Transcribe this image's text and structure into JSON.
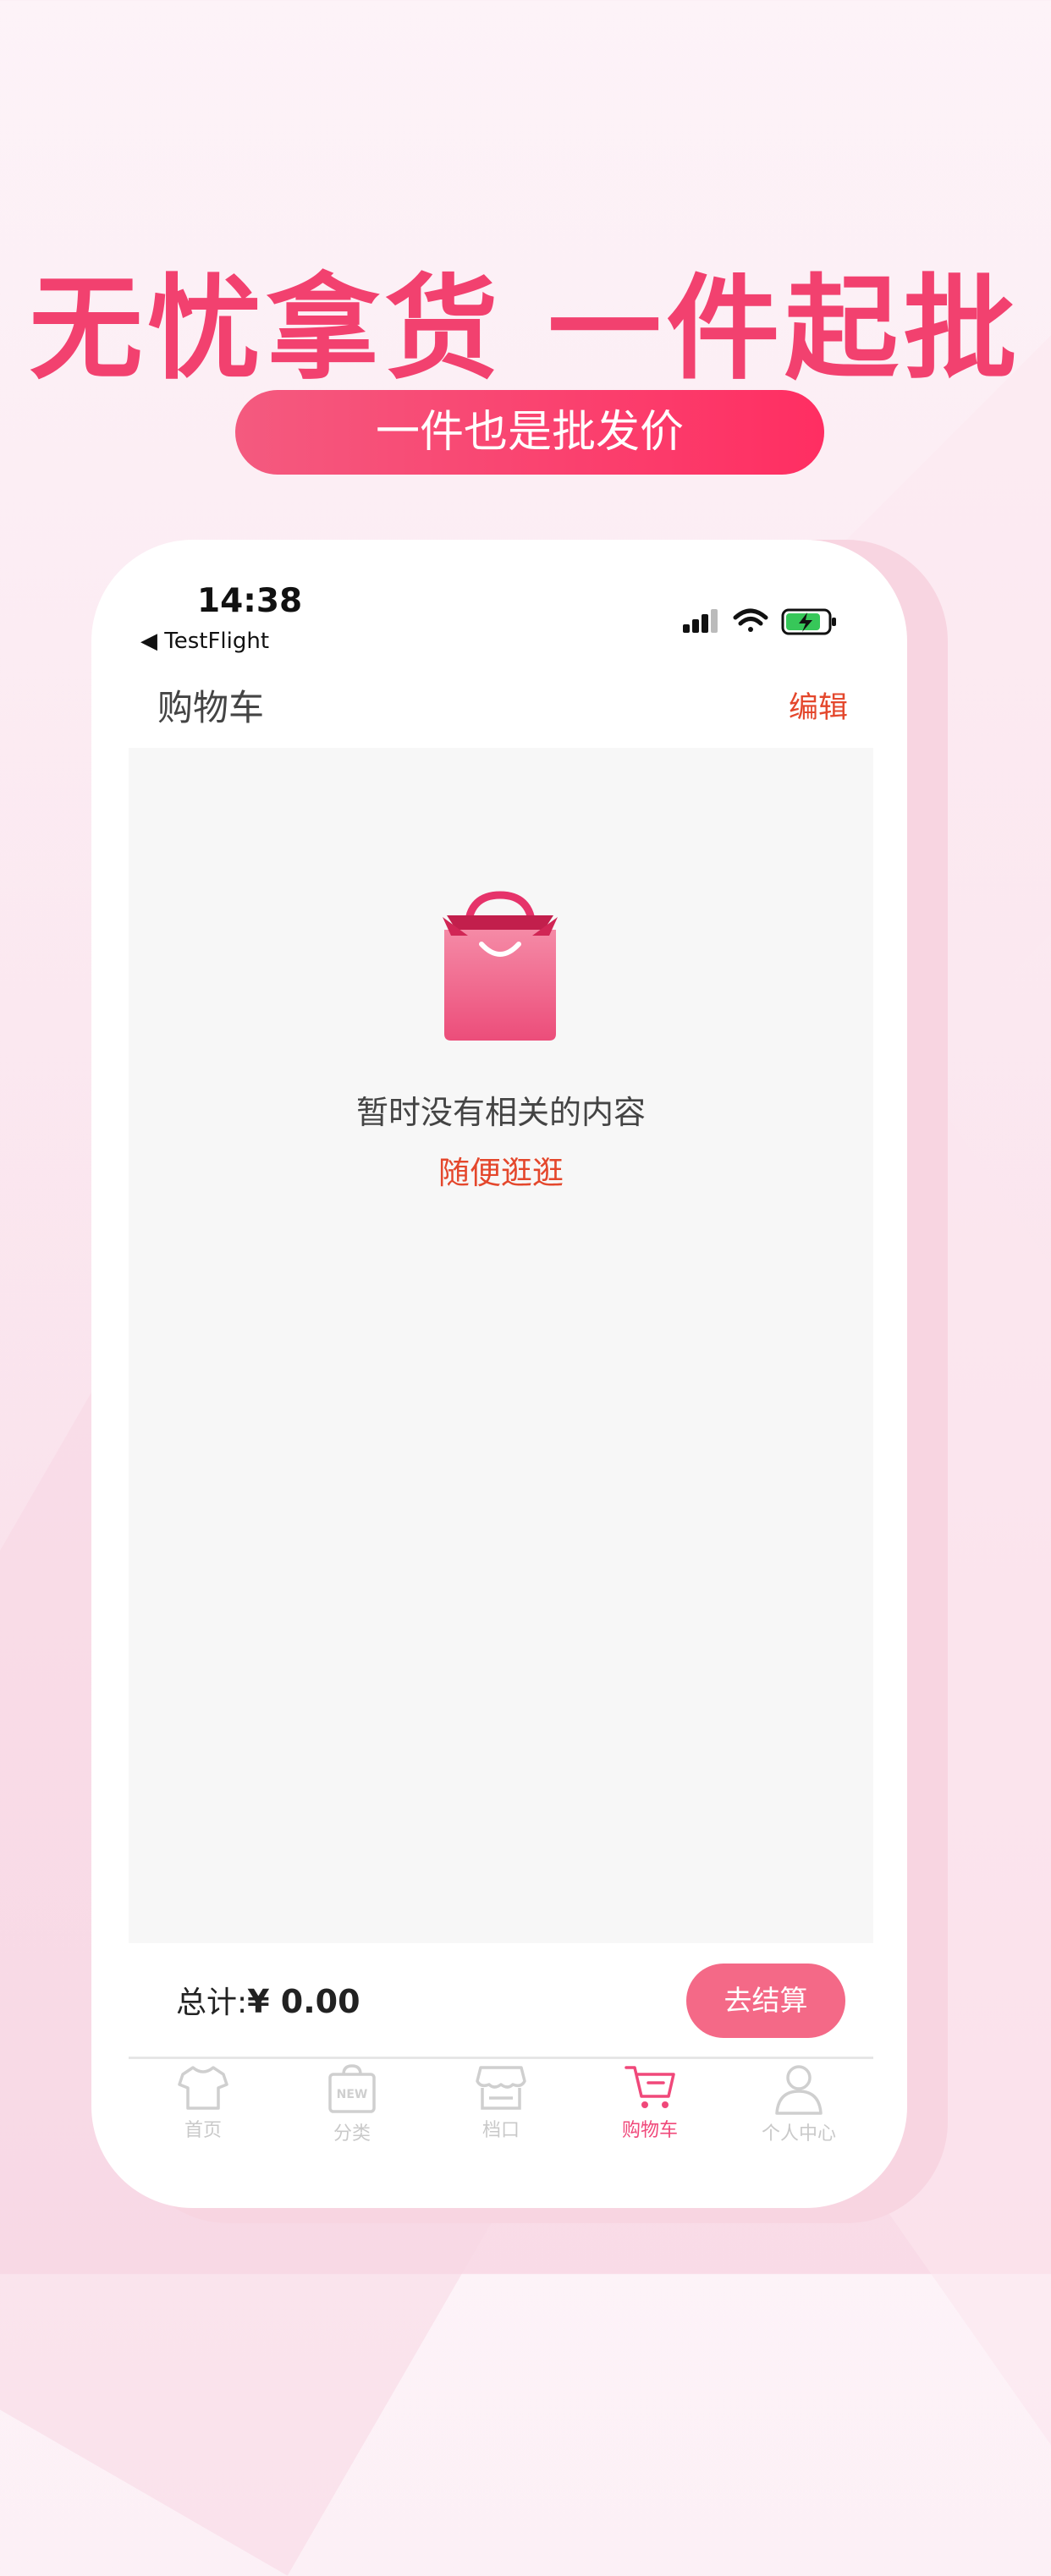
{
  "promo": {
    "headline": "无忧拿货 一件起批",
    "subline": "一件也是批发价",
    "accent_color": "#f2416f"
  },
  "status_bar": {
    "time": "14:38",
    "back_app": "◀ TestFlight",
    "icons": [
      "signal-icon",
      "wifi-icon",
      "battery-charging-icon"
    ]
  },
  "header": {
    "title": "购物车",
    "edit_label": "编辑"
  },
  "empty_state": {
    "icon": "shopping-bag-icon",
    "message": "暂时没有相关的内容",
    "link": "随便逛逛"
  },
  "footer": {
    "total_label": "总计:",
    "total_value": "¥ 0.00",
    "checkout_label": "去结算"
  },
  "tabbar": {
    "items": [
      {
        "label": "首页",
        "icon": "tshirt-icon",
        "active": false
      },
      {
        "label": "分类",
        "icon": "new-bag-icon",
        "active": false
      },
      {
        "label": "档口",
        "icon": "store-icon",
        "active": false
      },
      {
        "label": "购物车",
        "icon": "cart-icon",
        "active": true
      },
      {
        "label": "个人中心",
        "icon": "person-icon",
        "active": false
      }
    ]
  }
}
